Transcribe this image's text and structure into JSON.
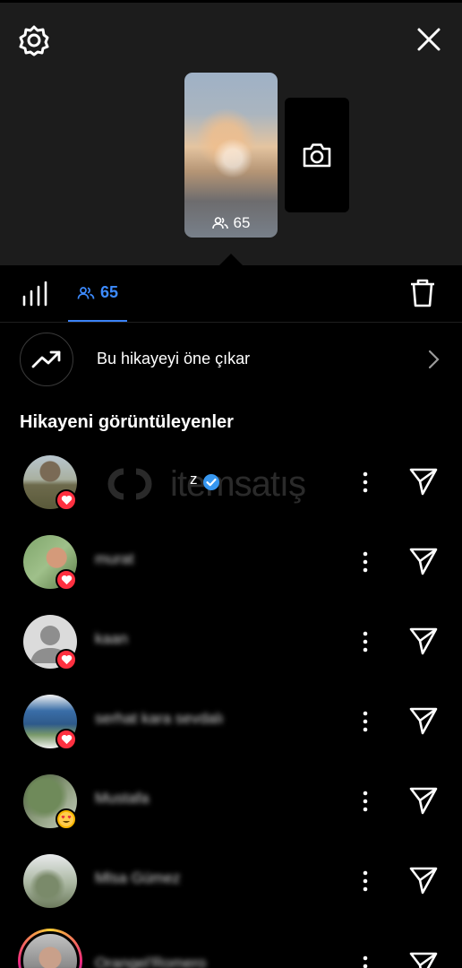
{
  "header": {
    "views_count": "65",
    "icons": {
      "settings": "gear-icon",
      "close": "close-icon",
      "camera": "camera-icon"
    }
  },
  "tabs": {
    "insights_icon": "bar-chart-icon",
    "viewers_count": "65",
    "delete_icon": "trash-icon",
    "active_color": "#3d8bff"
  },
  "promote": {
    "label": "Bu hikayeyi öne çıkar"
  },
  "viewers": {
    "title": "Hikayeni görüntüleyenler",
    "watermark": "itemsatış",
    "rows": [
      {
        "username": "z",
        "verified": true,
        "reaction": "heart"
      },
      {
        "username": "murat",
        "verified": false,
        "reaction": "heart"
      },
      {
        "username": "kaan",
        "verified": false,
        "reaction": "heart"
      },
      {
        "username": "serhat kara sevdalı",
        "verified": false,
        "reaction": "heart"
      },
      {
        "username": "Mustafa",
        "verified": false,
        "reaction": "heart-eyes"
      },
      {
        "username": "Mlsa Gümez",
        "verified": false,
        "reaction": "none"
      },
      {
        "username": "Orangel'Romero",
        "verified": false,
        "reaction": "none"
      }
    ]
  },
  "colors": {
    "background": "#000000",
    "top_panel": "#1c1c1c",
    "like_badge": "#ff3040",
    "verified": "#3797f0"
  }
}
